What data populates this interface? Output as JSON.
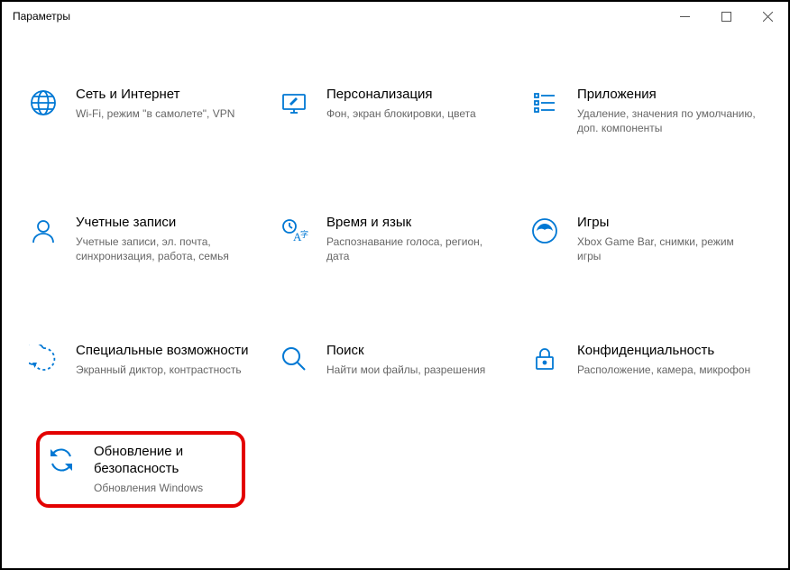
{
  "window": {
    "title": "Параметры"
  },
  "colors": {
    "accent": "#0078D4",
    "highlight": "#e30000"
  },
  "tiles": {
    "network": {
      "title": "Сеть и Интернет",
      "desc": "Wi-Fi, режим \"в самолете\", VPN"
    },
    "personalize": {
      "title": "Персонализация",
      "desc": "Фон, экран блокировки, цвета"
    },
    "apps": {
      "title": "Приложения",
      "desc": "Удаление, значения по умолчанию, доп. компоненты"
    },
    "accounts": {
      "title": "Учетные записи",
      "desc": "Учетные записи, эл. почта, синхронизация, работа, семья"
    },
    "timelang": {
      "title": "Время и язык",
      "desc": "Распознавание голоса, регион, дата"
    },
    "gaming": {
      "title": "Игры",
      "desc": "Xbox Game Bar, снимки, режим игры"
    },
    "ease": {
      "title": "Специальные возможности",
      "desc": "Экранный диктор, контрастность"
    },
    "search": {
      "title": "Поиск",
      "desc": "Найти мои файлы, разрешения"
    },
    "privacy": {
      "title": "Конфиденциальность",
      "desc": "Расположение, камера, микрофон"
    },
    "update": {
      "title": "Обновление и безопасность",
      "desc": "Обновления Windows"
    }
  }
}
